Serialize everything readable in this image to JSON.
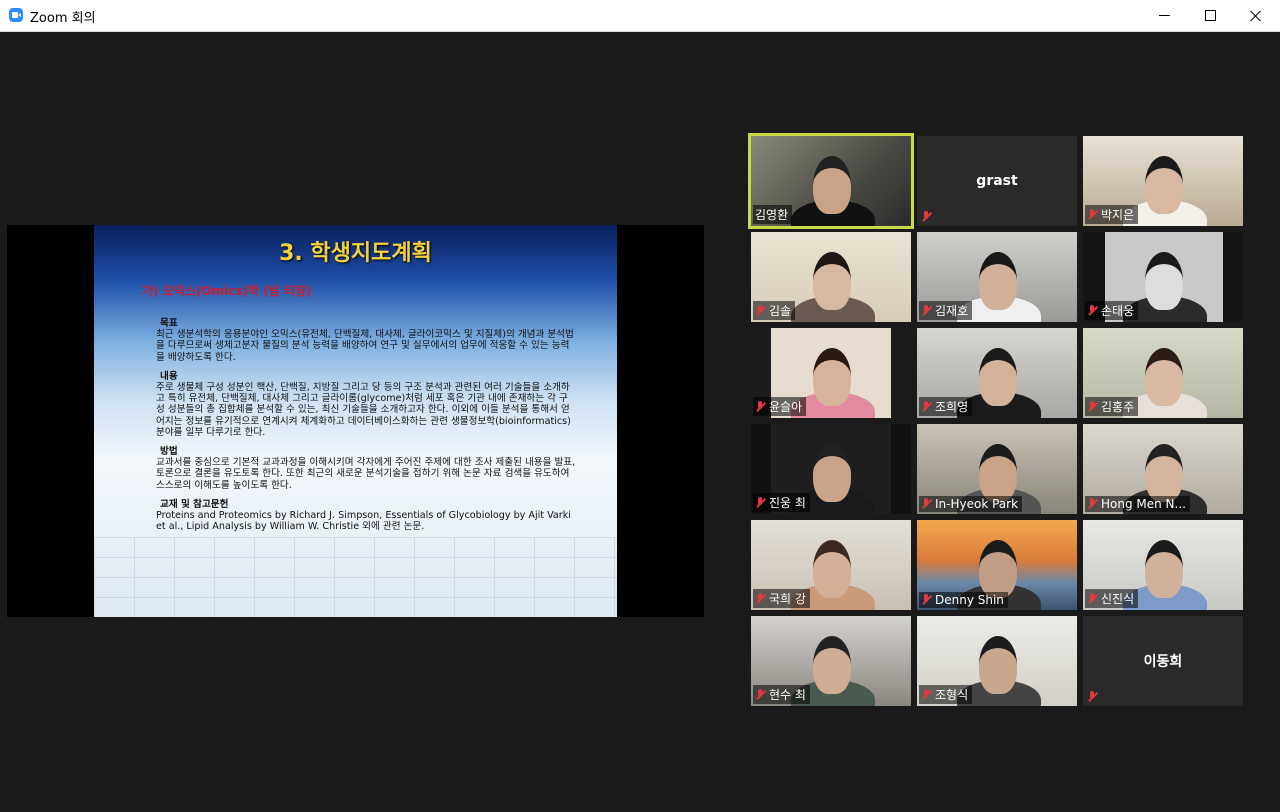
{
  "window": {
    "title": "Zoom 회의"
  },
  "slide": {
    "title": "3. 학생지도계획",
    "subtitle": "가) 오믹스(Omics)학 (팀 티칭)",
    "sections": [
      {
        "heading": "목표",
        "text": "최근 생분석학의 응용분야인 오믹스(유전체, 단백질체, 대사체, 글라이코믹스 및 지질체)의 개념과 분석법을 다루므로써 생체고분자 물질의 분석 능력을 배양하여 연구 및 실무에서의 업무에 적응할 수 있는 능력을 배양하도록 한다."
      },
      {
        "heading": "내용",
        "text": "주로 생물체 구성 성분인 핵산, 단백질, 지방질 그리고 당 등의 구조 분석과 관련된 여러 기술들을 소개하고 특히 유전체, 단백질체, 대사체 그리고 글라이롬(glycome)처럼 세포 혹은 기관 내에 존재하는 각 구성 성분들의 총 집합체를 분석할 수 있는, 최신 기술들을 소개하고자 한다. 이외에 이들 분석을 통해서 얻어지는 정보를 유기적으로 연계시켜 체계화하고 데이터베이스화하는 관련 생물정보학(bioinformatics)분야를 일부 다루기로 한다."
      },
      {
        "heading": "방법",
        "text": "교과서를 중심으로 기본적 교과과정을 이해시키며 각자에게 주어진 주제에 대한 조사 제출된 내용을 발표, 토론으로 결론을 유도토록 한다. 또한 최근의 새로운 분석기술을 접하기 위해 논문 자료 검색을 유도하여 스스로의 이해도를 높이도록 한다."
      },
      {
        "heading": "교재 및 참고문헌",
        "text": "Proteins and Proteomics by Richard J. Simpson, Essentials of Glycobiology by Ajit Varki et al., Lipid Analysis by William W. Christie 외에 관련 논문."
      }
    ]
  },
  "participants": [
    {
      "name": "김영환",
      "muted": false,
      "active": true
    },
    {
      "name": "grast",
      "muted": true,
      "video": false
    },
    {
      "name": "박지은",
      "muted": true
    },
    {
      "name": "김솔",
      "muted": true
    },
    {
      "name": "김재호",
      "muted": true
    },
    {
      "name": "손태웅",
      "muted": true
    },
    {
      "name": "윤슬아",
      "muted": true
    },
    {
      "name": "조희영",
      "muted": true
    },
    {
      "name": "김홍주",
      "muted": true
    },
    {
      "name": "진웅 최",
      "muted": true
    },
    {
      "name": "In-Hyeok Park",
      "muted": true
    },
    {
      "name": "Hong Men N...",
      "muted": true
    },
    {
      "name": "국희 강",
      "muted": true
    },
    {
      "name": "Denny Shin",
      "muted": true
    },
    {
      "name": "신진식",
      "muted": true
    },
    {
      "name": "현수 최",
      "muted": true
    },
    {
      "name": "조형식",
      "muted": true
    },
    {
      "name": "이동희",
      "muted": true,
      "video": false
    }
  ],
  "colors": {
    "active_speaker": "#c8d94a",
    "muted_icon": "#e0393e",
    "background": "#1a1a1a"
  }
}
